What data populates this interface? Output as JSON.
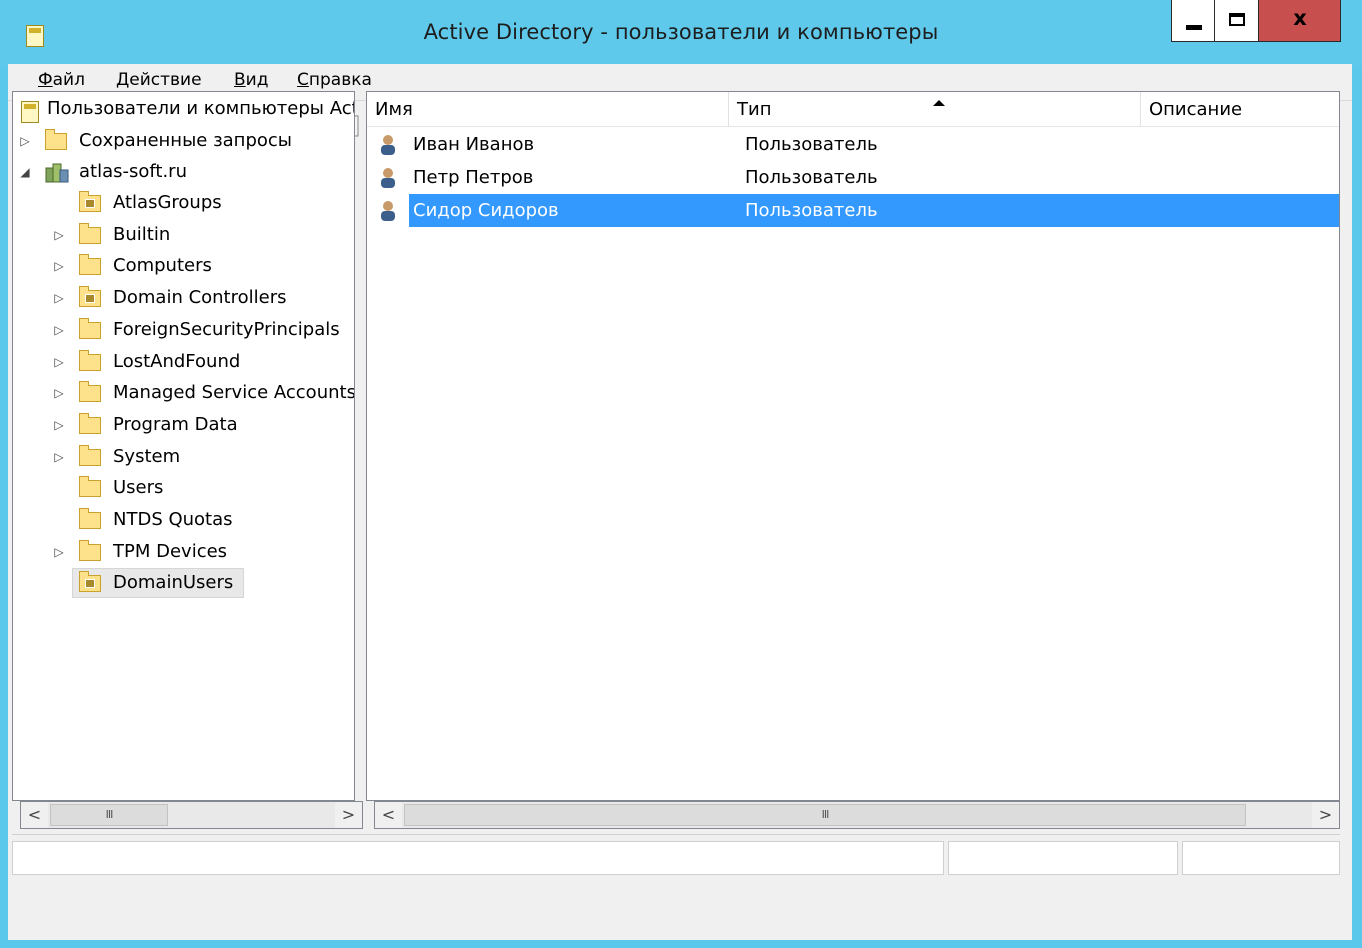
{
  "window": {
    "title": "Active Directory - пользователи и компьютеры",
    "close_glyph": "x"
  },
  "menu": [
    {
      "label": "Файл",
      "underline": "Ф",
      "rest": "айл"
    },
    {
      "label": "Действие",
      "underline": "Д",
      "rest": "ействие"
    },
    {
      "label": "Вид",
      "underline": "В",
      "rest": "ид"
    },
    {
      "label": "Справка",
      "underline": "С",
      "rest": "правка"
    }
  ],
  "toolbar": {
    "icons": [
      "back-icon",
      "forward-icon",
      "up-folder-icon",
      "show-console-tree-icon",
      "cut-icon",
      "paste-icon",
      "delete-icon",
      "properties-icon",
      "refresh-icon",
      "export-list-icon",
      "help-icon",
      "action-pane-icon",
      "new-user-icon",
      "new-group-icon",
      "new-ou-icon",
      "filter-icon",
      "find-icon",
      "add-to-group-icon"
    ]
  },
  "tree": {
    "root": "Пользователи и компьютеры Active Directory",
    "saved_queries": "Сохраненные запросы",
    "domain": "atlas-soft.ru",
    "containers": [
      {
        "label": "AtlasGroups",
        "expandable": false,
        "ou": true
      },
      {
        "label": "Builtin",
        "expandable": true,
        "ou": false
      },
      {
        "label": "Computers",
        "expandable": true,
        "ou": false
      },
      {
        "label": "Domain Controllers",
        "expandable": true,
        "ou": true
      },
      {
        "label": "ForeignSecurityPrincipals",
        "expandable": true,
        "ou": false
      },
      {
        "label": "LostAndFound",
        "expandable": true,
        "ou": false
      },
      {
        "label": "Managed Service Accounts",
        "expandable": true,
        "ou": false
      },
      {
        "label": "Program Data",
        "expandable": true,
        "ou": false
      },
      {
        "label": "System",
        "expandable": true,
        "ou": false
      },
      {
        "label": "Users",
        "expandable": false,
        "ou": false
      },
      {
        "label": "NTDS Quotas",
        "expandable": false,
        "ou": false
      },
      {
        "label": "TPM Devices",
        "expandable": true,
        "ou": false
      },
      {
        "label": "DomainUsers",
        "expandable": false,
        "ou": true,
        "selected": true
      }
    ]
  },
  "list": {
    "columns": [
      "Имя",
      "Тип",
      "Описание"
    ],
    "rows": [
      {
        "name": "Иван Иванов",
        "type": "Пользователь"
      },
      {
        "name": "Петр Петров",
        "type": "Пользователь"
      },
      {
        "name": "Сидор Сидоров",
        "type": "Пользователь",
        "selected": true
      }
    ]
  },
  "scroll": {
    "left_arrow": "<",
    "right_arrow": ">",
    "thumb_grip": "III"
  },
  "colors": {
    "titlebar": "#5ec9ea",
    "selection": "#3399ff",
    "close_button": "#c7504f"
  }
}
